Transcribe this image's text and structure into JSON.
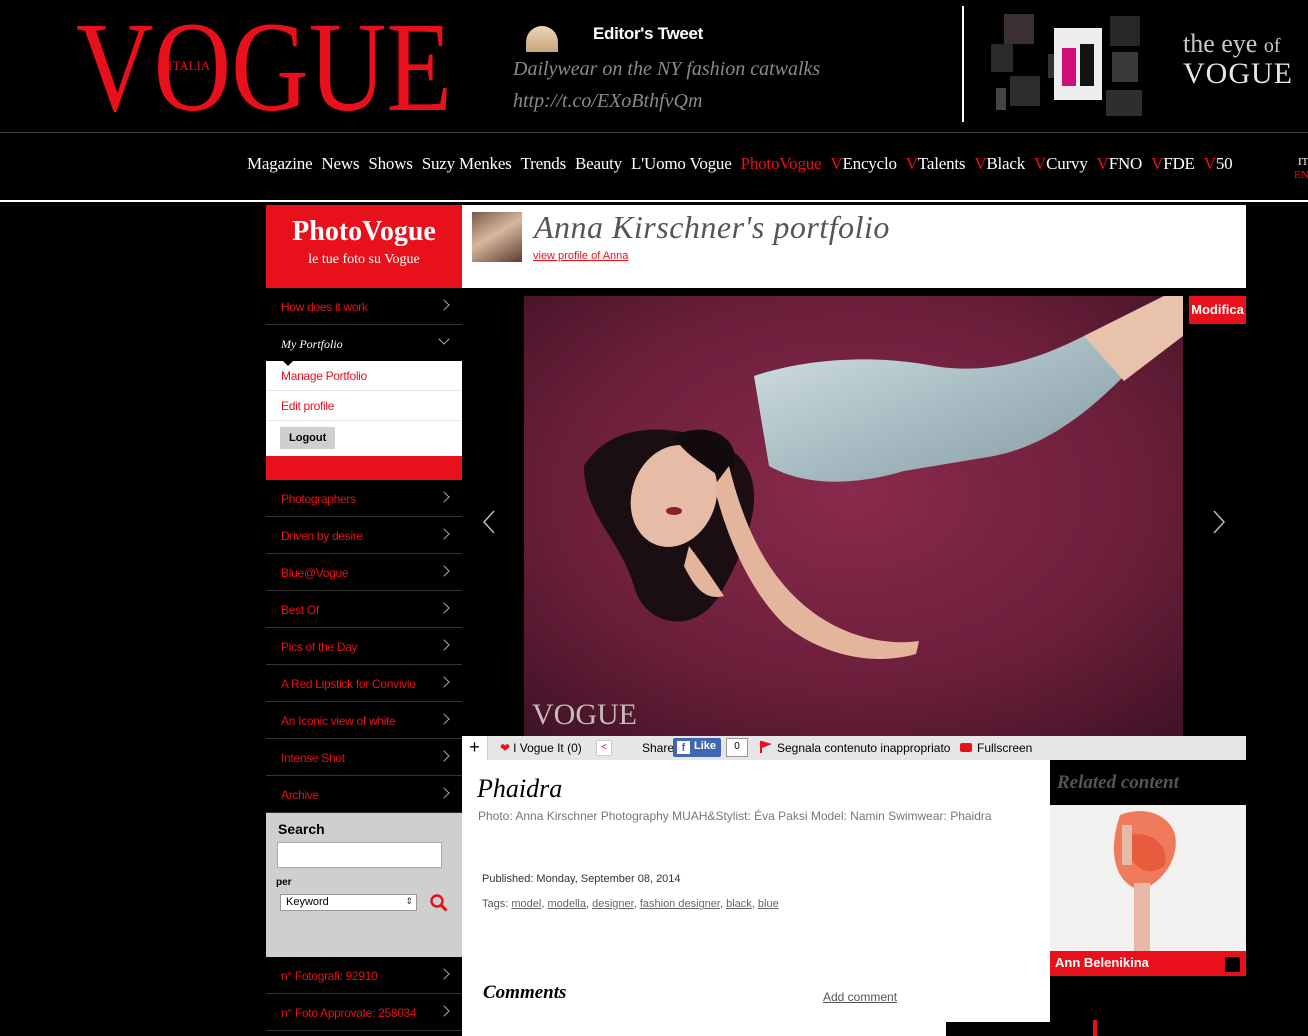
{
  "header": {
    "logo_text": "VOGUE",
    "logo_sub": "ITALIA",
    "tweet_title": "Editor's Tweet",
    "tweet_line1": "Dailywear on the NY fashion catwalks",
    "tweet_line2": "http://t.co/EXoBthfvQm",
    "eye_title_a": "the eye",
    "eye_title_of": "of",
    "eye_title_vogue": "VOGUE"
  },
  "nav": {
    "items": [
      "Magazine",
      "News",
      "Shows",
      "Suzy Menkes",
      "Trends",
      "Beauty",
      "L'Uomo Vogue",
      "PhotoVogue"
    ],
    "v_prefix": "V",
    "v_items": [
      "Encyclo",
      "Talents",
      "Black",
      "Curvy",
      "FNO",
      "FDE",
      "50"
    ],
    "lang_it": "IT",
    "lang_en": "EN"
  },
  "sidebar": {
    "brand": "PhotoVogue",
    "brand_sub": "le tue foto su Vogue",
    "how": "How does it work",
    "my_portfolio": "My Portfolio",
    "manage": "Manage Portfolio",
    "edit_profile": "Edit profile",
    "logout": "Logout",
    "items": [
      "Photographers",
      "Driven by desire",
      "Blue@Vogue",
      "Best Of",
      "Pics of the Day",
      "A Red Lipstick for Convivio",
      "An Iconic view of white",
      "Intense Shot",
      "Archive"
    ],
    "search_label": "Search",
    "search_value": "",
    "per_label": "per",
    "per_selected": "Keyword",
    "stat_photographers": "n° Fotografi: 92910",
    "stat_photos": "n° Foto Approvate: 258034"
  },
  "portfolio": {
    "title": "Anna Kirschner's portfolio",
    "profile_link": "view profile of Anna",
    "modifica": "Modifica",
    "watermark": "VOGUE"
  },
  "actions": {
    "plus": "+",
    "ivogue": "I Vogue It (0)",
    "share": "Share",
    "fb_like": "Like",
    "fb_count": "0",
    "report": "Segnala contenuto inappropriato",
    "fullscreen": "Fullscreen"
  },
  "photo_info": {
    "title": "Phaidra",
    "credits": "Photo: Anna Kirschner Photography MUAH&Stylist: Éva Paksi Model: Namin Swimwear: Phaidra",
    "published": "Published: Monday, September 08, 2014",
    "tags_label": "Tags:",
    "tags": [
      "model",
      "modella",
      "designer",
      "fashion designer",
      "black",
      "blue"
    ],
    "comments_title": "Comments",
    "add_comment": "Add comment"
  },
  "related": {
    "title": "Related content",
    "item_name": "Ann Belenikina"
  },
  "colors": {
    "vogue_red": "#e8101a",
    "bg": "#000000"
  }
}
